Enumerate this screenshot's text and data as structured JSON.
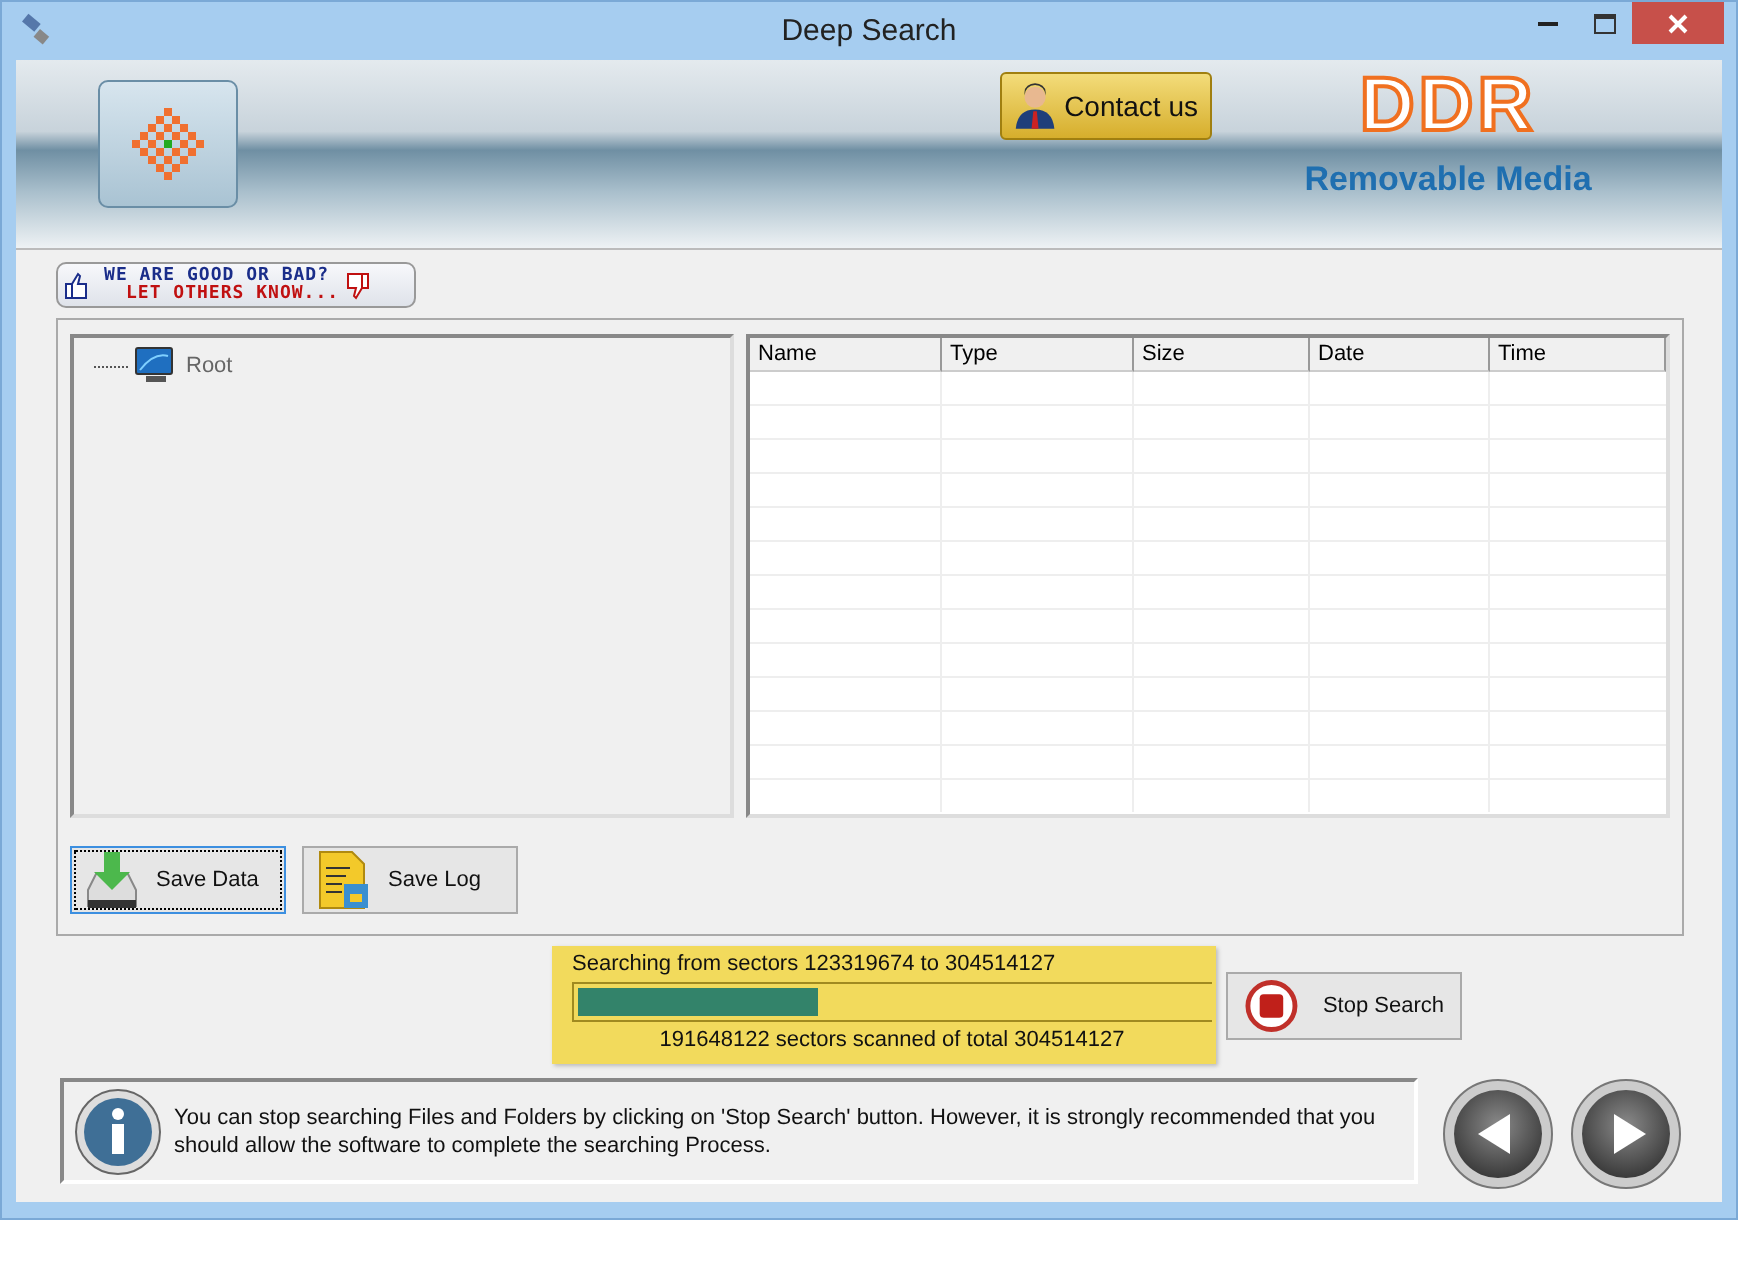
{
  "window": {
    "title": "Deep Search"
  },
  "header": {
    "contact_button": "Contact us",
    "brand": "DDR",
    "product": "Removable Media"
  },
  "feedback_banner": {
    "line_1": "WE ARE GOOD OR BAD?",
    "line_2": "LET OTHERS KNOW..."
  },
  "tree": {
    "items": [
      {
        "label": "Root"
      }
    ]
  },
  "table": {
    "columns": [
      "Name",
      "Type",
      "Size",
      "Date",
      "Time"
    ]
  },
  "buttons": [
    {
      "kind": "save-data",
      "label": "Save Data",
      "focused": true
    },
    {
      "kind": "save-log",
      "label": "Save Log",
      "focused": false
    }
  ],
  "progress": {
    "range_text": "Searching from sectors  123319674 to 304514127",
    "level": 0.38,
    "scanned_text": "191648122  sectors scanned of total 304514127"
  },
  "stop_button": "Stop Search",
  "info": "You can stop searching Files and Folders by clicking on 'Stop Search' button. However, it is strongly recommended that you should allow the software to complete the searching Process."
}
